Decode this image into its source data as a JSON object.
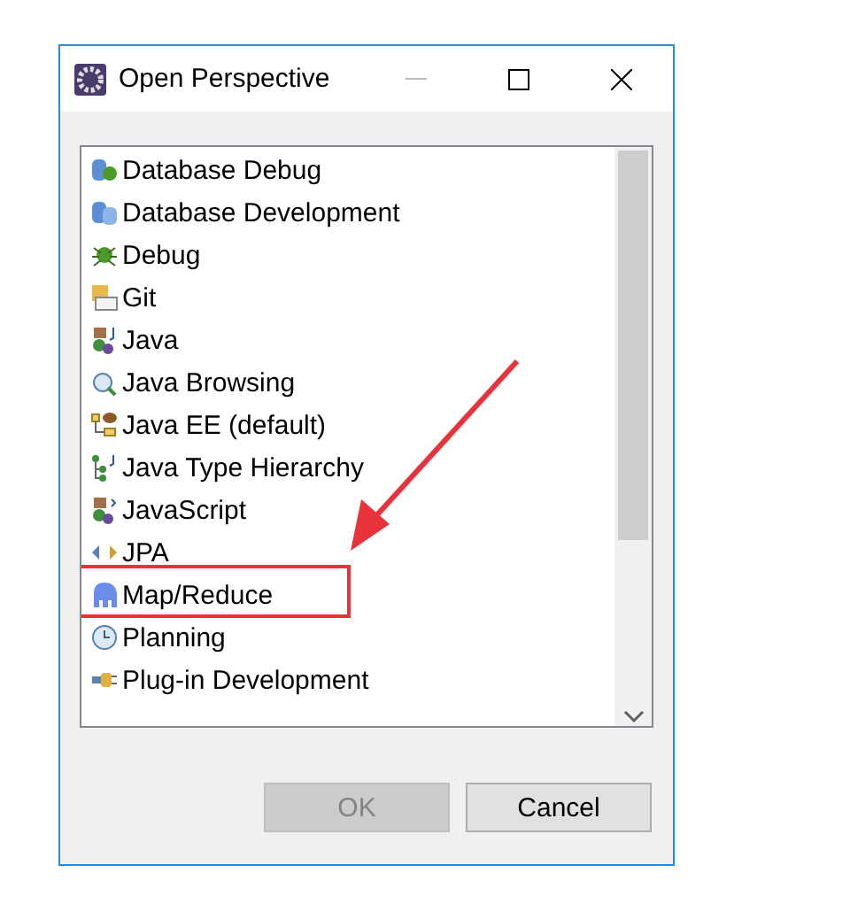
{
  "window": {
    "title": "Open Perspective"
  },
  "perspectives": [
    {
      "label": "Database Debug",
      "selected": false,
      "highlighted": false
    },
    {
      "label": "Database Development",
      "selected": false,
      "highlighted": false
    },
    {
      "label": "Debug",
      "selected": false,
      "highlighted": false
    },
    {
      "label": "Git",
      "selected": false,
      "highlighted": false
    },
    {
      "label": "Java",
      "selected": false,
      "highlighted": false
    },
    {
      "label": "Java Browsing",
      "selected": false,
      "highlighted": false
    },
    {
      "label": "Java EE (default)",
      "selected": false,
      "highlighted": false
    },
    {
      "label": "Java Type Hierarchy",
      "selected": false,
      "highlighted": false
    },
    {
      "label": "JavaScript",
      "selected": false,
      "highlighted": false
    },
    {
      "label": "JPA",
      "selected": false,
      "highlighted": false
    },
    {
      "label": "Map/Reduce",
      "selected": false,
      "highlighted": true
    },
    {
      "label": "Planning",
      "selected": false,
      "highlighted": false
    },
    {
      "label": "Plug-in Development",
      "selected": false,
      "highlighted": false
    }
  ],
  "buttons": [
    {
      "label": "OK",
      "disabled": true
    },
    {
      "label": "Cancel",
      "disabled": false
    }
  ]
}
